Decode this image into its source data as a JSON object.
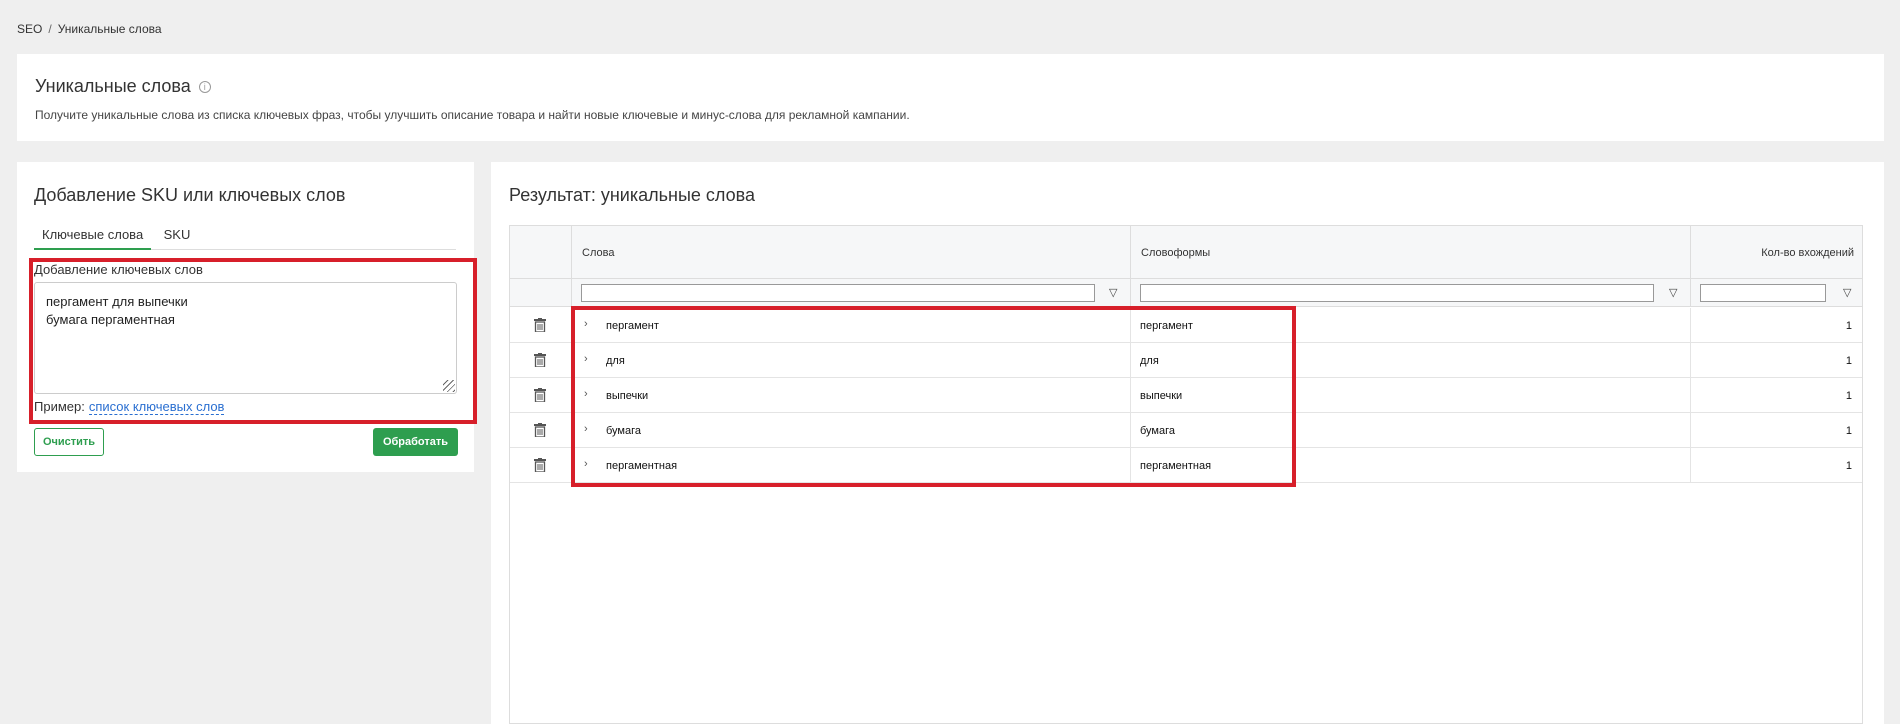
{
  "breadcrumb": {
    "root": "SEO",
    "separator": "/",
    "current": "Уникальные слова"
  },
  "header": {
    "title": "Уникальные слова",
    "info_icon": "i",
    "description": "Получите уникальные слова из списка ключевых фраз, чтобы улучшить описание товара и найти новые ключевые и минус-слова для рекламной кампании."
  },
  "left_panel": {
    "title": "Добавление SKU или ключевых слов",
    "tabs": [
      {
        "label": "Ключевые слова",
        "active": true
      },
      {
        "label": "SKU",
        "active": false
      }
    ],
    "field_label": "Добавление ключевых слов",
    "textarea_value": "пергамент для выпечки\nбумага пергаментная",
    "example_prefix": "Пример:",
    "example_link": "список ключевых слов",
    "clear_button": "Очистить",
    "process_button": "Обработать"
  },
  "right_panel": {
    "title": "Результат: уникальные слова",
    "columns": [
      "Слова",
      "Словоформы",
      "Кол-во вхождений"
    ],
    "rows": [
      {
        "word": "пергамент",
        "form": "пергамент",
        "count": "1"
      },
      {
        "word": "для",
        "form": "для",
        "count": "1"
      },
      {
        "word": "выпечки",
        "form": "выпечки",
        "count": "1"
      },
      {
        "word": "бумага",
        "form": "бумага",
        "count": "1"
      },
      {
        "word": "пергаментная",
        "form": "пергаментная",
        "count": "1"
      }
    ]
  },
  "colors": {
    "accent": "#2e9e4f",
    "highlight": "#d71f2a",
    "link": "#2a6fd1"
  },
  "icons": [
    "info-icon",
    "trash-icon",
    "chevron-right-icon",
    "filter-icon",
    "resize-grip-icon"
  ]
}
